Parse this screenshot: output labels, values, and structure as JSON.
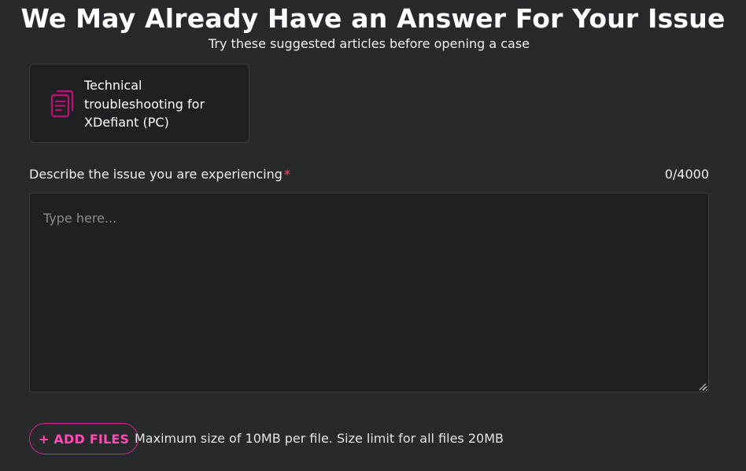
{
  "header": {
    "title": "We May Already Have an Answer For Your Issue",
    "subtitle": "Try these suggested articles before opening a case"
  },
  "suggested_articles": [
    {
      "title": "Technical troubleshooting for XDefiant (PC)",
      "icon": "document-copy-icon"
    }
  ],
  "issue_field": {
    "label": "Describe the issue you are experiencing",
    "required_marker": "*",
    "counter": "0/4000",
    "placeholder": "Type here...",
    "value": ""
  },
  "attachments": {
    "add_files_label": "+ ADD FILES",
    "limit_text": "Maximum size of 10MB per file. Size limit for all files 20MB"
  },
  "colors": {
    "background": "#27292b",
    "card_background": "#1f2022",
    "accent_pink": "#ff4ab5",
    "icon_magenta": "#b3146f",
    "required_red": "#ff4d6a"
  }
}
